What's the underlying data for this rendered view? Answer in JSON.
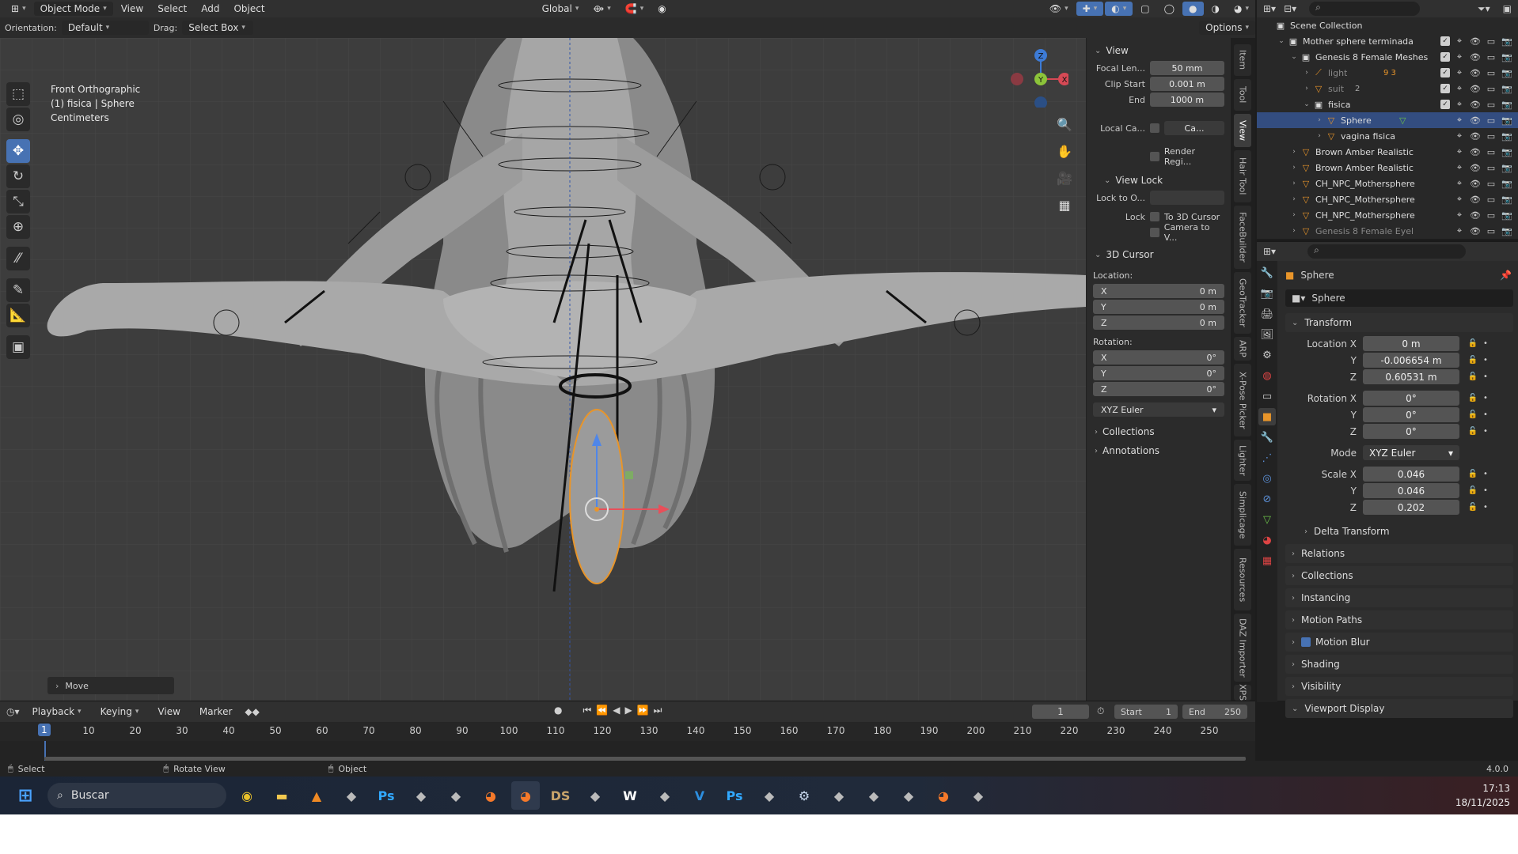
{
  "header": {
    "mode": "Object Mode",
    "menus": [
      "View",
      "Select",
      "Add",
      "Object"
    ],
    "transform_orientation": "Global"
  },
  "tool_header": {
    "orientation_label": "Orientation:",
    "orientation_value": "Default",
    "drag_label": "Drag:",
    "drag_value": "Select Box",
    "options": "Options"
  },
  "viewport": {
    "view_name": "Front Orthographic",
    "object_info": "(1) fisica | Sphere",
    "units": "Centimeters",
    "last_op": "Move",
    "gizmo": {
      "z": "Z",
      "y": "Y",
      "x": "X"
    }
  },
  "npanel": {
    "view_header": "View",
    "focal_label": "Focal Len...",
    "focal_value": "50 mm",
    "clip_start_label": "Clip Start",
    "clip_start_value": "0.001 m",
    "clip_end_label": "End",
    "clip_end_value": "1000 m",
    "local_cam_label": "Local Ca...",
    "local_cam_value": "Ca...",
    "render_region": "Render Regi...",
    "view_lock_header": "View Lock",
    "lock_to_label": "Lock to O...",
    "lock_label": "Lock",
    "lock_3d_cursor": "To 3D Cursor",
    "lock_camera": "Camera to V...",
    "cursor_header": "3D Cursor",
    "location_label": "Location:",
    "loc_x": "0 m",
    "loc_y": "0 m",
    "loc_z": "0 m",
    "rotation_label": "Rotation:",
    "rot_x": "0°",
    "rot_y": "0°",
    "rot_z": "0°",
    "rot_mode": "XYZ Euler",
    "collections": "Collections",
    "annotations": "Annotations",
    "axis_x": "X",
    "axis_y": "Y",
    "axis_z": "Z"
  },
  "vertical_tabs": [
    "Item",
    "Tool",
    "View",
    "Hair Tool",
    "FaceBuilder",
    "GeoTracker",
    "ARP",
    "X-Pose Picker",
    "Lighter",
    "Simplicage",
    "Resources",
    "DAZ Importer",
    "XPS"
  ],
  "outliner": {
    "rows": [
      {
        "name": "Scene Collection",
        "indent": 0,
        "icon": "collection"
      },
      {
        "name": "Mother sphere terminada",
        "indent": 1,
        "icon": "collection"
      },
      {
        "name": "Genesis 8 Female Meshes",
        "indent": 2,
        "icon": "collection"
      },
      {
        "name": "light",
        "indent": 3,
        "icon": "armature",
        "dim": true
      },
      {
        "name": "suit",
        "indent": 3,
        "icon": "mesh",
        "dim": true
      },
      {
        "name": "fisica",
        "indent": 3,
        "icon": "collection"
      },
      {
        "name": "Sphere",
        "indent": 4,
        "icon": "mesh",
        "selected": true
      },
      {
        "name": "vagina fisica",
        "indent": 4,
        "icon": "mesh"
      },
      {
        "name": "Brown Amber Realistic",
        "indent": 2,
        "icon": "mesh"
      },
      {
        "name": "Brown Amber Realistic",
        "indent": 2,
        "icon": "mesh"
      },
      {
        "name": "CH_NPC_Mothersphere",
        "indent": 2,
        "icon": "mesh"
      },
      {
        "name": "CH_NPC_Mothersphere",
        "indent": 2,
        "icon": "mesh"
      },
      {
        "name": "CH_NPC_Mothersphere",
        "indent": 2,
        "icon": "mesh"
      },
      {
        "name": "Genesis 8 Female Eyel",
        "indent": 2,
        "icon": "mesh",
        "dim": true
      }
    ],
    "light_badges": "9 3",
    "suit_badge": "2"
  },
  "properties": {
    "object_name": "Sphere",
    "data_name": "Sphere",
    "transform_header": "Transform",
    "loc_label": "Location X",
    "loc_x": "0 m",
    "loc_y": "-0.006654 m",
    "loc_z": "0.60531 m",
    "rot_label": "Rotation X",
    "rot_x": "0°",
    "rot_y": "0°",
    "rot_z": "0°",
    "mode_label": "Mode",
    "mode_value": "XYZ Euler",
    "scale_label": "Scale X",
    "scale_x": "0.046",
    "scale_y": "0.046",
    "scale_z": "0.202",
    "y_label": "Y",
    "z_label": "Z",
    "delta": "Delta Transform",
    "panels": [
      "Relations",
      "Collections",
      "Instancing",
      "Motion Paths",
      "Motion Blur",
      "Shading",
      "Visibility",
      "Viewport Display"
    ]
  },
  "timeline": {
    "menus": [
      "Playback",
      "Keying",
      "View",
      "Marker"
    ],
    "current_frame": "1",
    "start_label": "Start",
    "start": "1",
    "end_label": "End",
    "end": "250",
    "ticks": [
      "10",
      "20",
      "30",
      "40",
      "50",
      "60",
      "70",
      "80",
      "90",
      "100",
      "110",
      "120",
      "130",
      "140",
      "150",
      "160",
      "170",
      "180",
      "190",
      "200",
      "210",
      "220",
      "230",
      "240",
      "250"
    ]
  },
  "statusbar": {
    "select": "Select",
    "rotate": "Rotate View",
    "object": "Object",
    "version": "4.0.0"
  },
  "taskbar": {
    "search": "Buscar",
    "time": "17:13",
    "date": "18/11/2025",
    "apps": [
      "chrome",
      "files",
      "vlc",
      "app",
      "Ps",
      "app",
      "app",
      "blender",
      "blender",
      "DS",
      "app",
      "W",
      "app",
      "V",
      "Ps",
      "app",
      "steam",
      "app",
      "app",
      "app",
      "blender",
      "app"
    ]
  }
}
